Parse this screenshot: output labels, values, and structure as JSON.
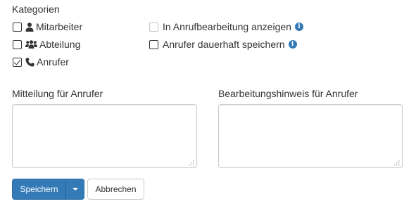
{
  "section": {
    "title": "Kategorien"
  },
  "categories": [
    {
      "label": "Mitarbeiter",
      "checked": false,
      "icon": "user-icon"
    },
    {
      "label": "Abteilung",
      "checked": false,
      "icon": "users-icon"
    },
    {
      "label": "Anrufer",
      "checked": true,
      "icon": "phone-icon"
    }
  ],
  "options": [
    {
      "label": "In Anrufbearbeitung anzeigen",
      "checked": false,
      "disabled": true,
      "icon": "info-icon"
    },
    {
      "label": "Anrufer dauerhaft speichern",
      "checked": false,
      "disabled": false,
      "icon": "info-icon"
    }
  ],
  "fields": {
    "message": {
      "label": "Mitteilung für Anrufer",
      "value": ""
    },
    "note": {
      "label": "Bearbeitungshinweis für Anrufer",
      "value": ""
    }
  },
  "buttons": {
    "save": "Speichern",
    "cancel": "Abbrechen"
  },
  "colors": {
    "primary": "#337ab7",
    "info": "#337ab7",
    "text": "#333333",
    "border": "#cccccc"
  }
}
